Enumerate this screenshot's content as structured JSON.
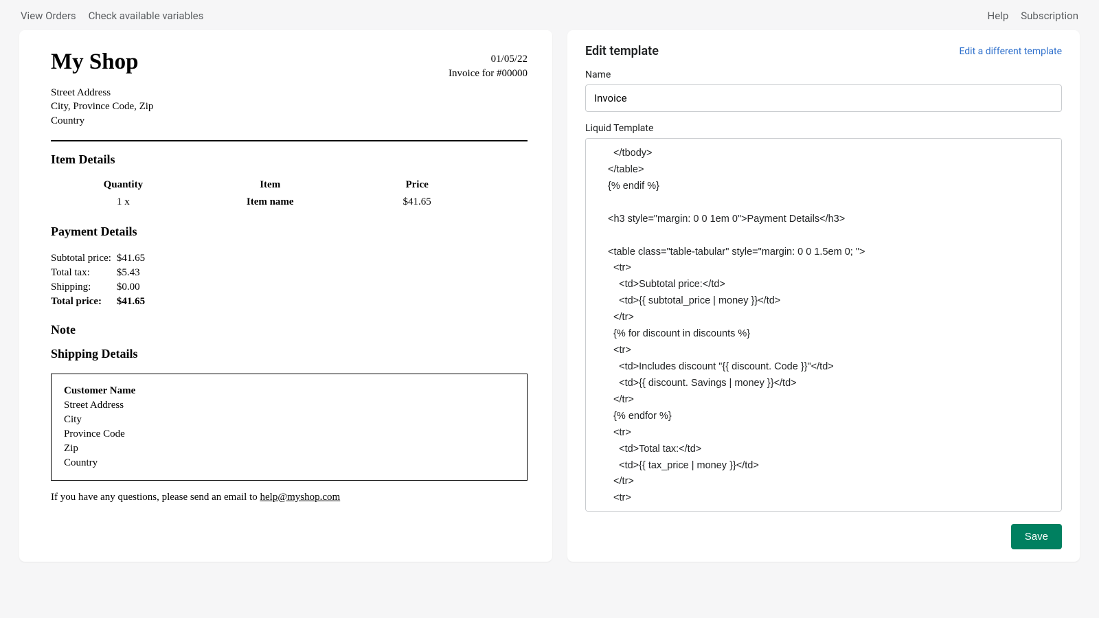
{
  "topbar": {
    "view_orders": "View Orders",
    "check_variables": "Check available variables",
    "help": "Help",
    "subscription": "Subscription"
  },
  "preview": {
    "shop_name": "My Shop",
    "date": "01/05/22",
    "invoice_for": "Invoice for #00000",
    "address_line1": "Street Address",
    "address_line2": "City, Province Code, Zip",
    "address_line3": "Country",
    "item_details_heading": "Item Details",
    "col_quantity": "Quantity",
    "col_item": "Item",
    "col_price": "Price",
    "row_qty": "1 x",
    "row_item": "Item name",
    "row_price": "$41.65",
    "payment_heading": "Payment Details",
    "subtotal_label": "Subtotal price:",
    "subtotal_value": "$41.65",
    "tax_label": "Total tax:",
    "tax_value": "$5.43",
    "shipping_label": "Shipping:",
    "shipping_value": "$0.00",
    "total_label": "Total price:",
    "total_value": "$41.65",
    "note_heading": "Note",
    "shipping_heading": "Shipping Details",
    "cust_name": "Customer Name",
    "ship_street": "Street Address",
    "ship_city": "City",
    "ship_province": "Province Code",
    "ship_zip": "Zip",
    "ship_country": "Country",
    "footer_prefix": "If you have any questions, please send an email to ",
    "footer_email": "help@myshop.com"
  },
  "editor": {
    "title": "Edit template",
    "switch_link": "Edit a different template",
    "name_label": "Name",
    "name_value": "Invoice",
    "liquid_label": "Liquid Template",
    "save_label": "Save",
    "code": "  </tbody>\n</table>\n{% endif %}\n\n<h3 style=\"margin: 0 0 1em 0\">Payment Details</h3>\n\n<table class=\"table-tabular\" style=\"margin: 0 0 1.5em 0; \">\n  <tr>\n    <td>Subtotal price:</td>\n    <td>{{ subtotal_price | money }}</td>\n  </tr>\n  {% for discount in discounts %}\n  <tr>\n    <td>Includes discount \"{{ discount. Code }}\"</td>\n    <td>{{ discount. Savings | money }}</td>\n  </tr>\n  {% endfor %}\n  <tr>\n    <td>Total tax:</td>\n    <td>{{ tax_price | money }}</td>\n  </tr>\n  <tr>\n"
  }
}
